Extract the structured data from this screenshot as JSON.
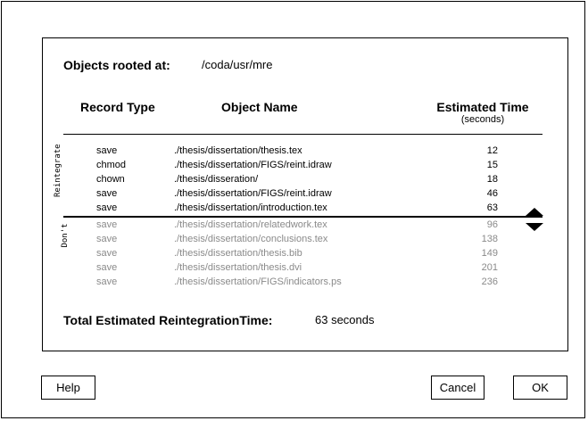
{
  "objects_rooted": {
    "label": "Objects rooted at:",
    "path": "/coda/usr/mre"
  },
  "columns": {
    "record_type": "Record Type",
    "object_name": "Object Name",
    "estimated_time": "Estimated Time",
    "estimated_time_unit": "(seconds)"
  },
  "groups": {
    "reintegrate": "Reintegrate",
    "dont": "Don't"
  },
  "reintegrate_rows": [
    {
      "type": "save",
      "name": "./thesis/dissertation/thesis.tex",
      "time": "12"
    },
    {
      "type": "chmod",
      "name": "./thesis/dissertation/FIGS/reint.idraw",
      "time": "15"
    },
    {
      "type": "chown",
      "name": "./thesis/disseration/",
      "time": "18"
    },
    {
      "type": "save",
      "name": "./thesis/dissertation/FIGS/reint.idraw",
      "time": "46"
    },
    {
      "type": "save",
      "name": "./thesis/dissertation/introduction.tex",
      "time": "63"
    }
  ],
  "dont_rows": [
    {
      "type": "save",
      "name": "./thesis/dissertation/relatedwork.tex",
      "time": "96"
    },
    {
      "type": "save",
      "name": "./thesis/dissertation/conclusions.tex",
      "time": "138"
    },
    {
      "type": "save",
      "name": "./thesis/dissertation/thesis.bib",
      "time": "149"
    },
    {
      "type": "save",
      "name": "./thesis/dissertation/thesis.dvi",
      "time": "201"
    },
    {
      "type": "save",
      "name": "./thesis/dissertation/FIGS/indicators.ps",
      "time": "236"
    }
  ],
  "total": {
    "label": "Total Estimated ReintegrationTime:",
    "value": "63 seconds"
  },
  "buttons": {
    "help": "Help",
    "cancel": "Cancel",
    "ok": "OK"
  },
  "icons": {
    "divider_handle": "up-down-arrows-icon"
  },
  "colors": {
    "dimmed_text": "#8a8a8a"
  }
}
